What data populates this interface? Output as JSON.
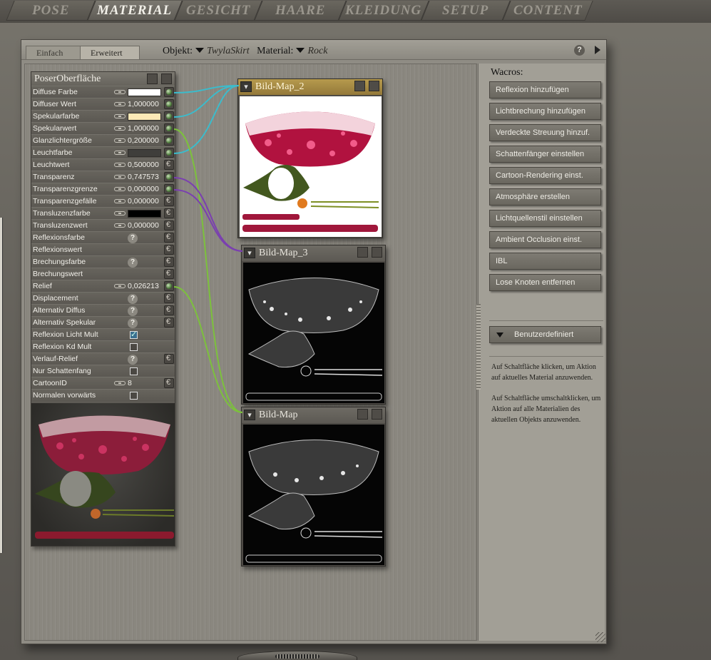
{
  "tabs": [
    "POSE",
    "MATERIAL",
    "GESICHT",
    "HAARE",
    "KLEIDUNG",
    "SETUP",
    "CONTENT"
  ],
  "active_tab": "MATERIAL",
  "subtabs": {
    "simple": "Einfach",
    "advanced": "Erweitert"
  },
  "object": {
    "label": "Objekt:",
    "value": "TwylaSkirt"
  },
  "material": {
    "label": "Material:",
    "value": "Rock"
  },
  "help_glyph": "?",
  "poser_node": {
    "title": "PoserOberfläche",
    "rows": [
      {
        "label": "Diffuse Farbe",
        "kind": "color",
        "color": "#ffffff",
        "port": "ball"
      },
      {
        "label": "Diffuser Wert",
        "kind": "value",
        "value": "1,000000",
        "port": "ball"
      },
      {
        "label": "Spekularfarbe",
        "kind": "color",
        "color": "#fde9b6",
        "port": "ball"
      },
      {
        "label": "Spekularwert",
        "kind": "value",
        "value": "1,000000",
        "port": "ball"
      },
      {
        "label": "Glanzlichtergröße",
        "kind": "value",
        "value": "0,200000",
        "port": "ball"
      },
      {
        "label": "Leuchtfarbe",
        "kind": "color",
        "color": "#3f3e3b",
        "port": "ball"
      },
      {
        "label": "Leuchtwert",
        "kind": "value",
        "value": "0,500000",
        "port": "c"
      },
      {
        "label": "Transparenz",
        "kind": "value",
        "value": "0,747573",
        "port": "ball"
      },
      {
        "label": "Transparenzgrenze",
        "kind": "value",
        "value": "0,000000",
        "port": "ball"
      },
      {
        "label": "Transparenzgefälle",
        "kind": "value",
        "value": "0,000000",
        "port": "c"
      },
      {
        "label": "Transluzenzfarbe",
        "kind": "color",
        "color": "#000000",
        "port": "c"
      },
      {
        "label": "Transluzenzwert",
        "kind": "value",
        "value": "0,000000",
        "port": "c"
      },
      {
        "label": "Reflexionsfarbe",
        "kind": "q",
        "port": "c"
      },
      {
        "label": "Reflexionswert",
        "kind": "none",
        "port": "c"
      },
      {
        "label": "Brechungsfarbe",
        "kind": "q",
        "port": "c"
      },
      {
        "label": "Brechungswert",
        "kind": "none",
        "port": "c"
      },
      {
        "label": "Relief",
        "kind": "value",
        "value": "0,026213",
        "port": "ball"
      },
      {
        "label": "Displacement",
        "kind": "q",
        "port": "c"
      },
      {
        "label": "Alternativ Diffus",
        "kind": "q",
        "port": "c"
      },
      {
        "label": "Alternativ Spekular",
        "kind": "q",
        "port": "c"
      },
      {
        "label": "Reflexion Licht Mult",
        "kind": "check",
        "checked": true,
        "port": "none"
      },
      {
        "label": "Reflexion Kd Mult",
        "kind": "check",
        "checked": false,
        "port": "none"
      },
      {
        "label": "Verlauf-Relief",
        "kind": "q",
        "port": "c"
      },
      {
        "label": "Nur Schattenfang",
        "kind": "check",
        "checked": false,
        "port": "none"
      },
      {
        "label": "CartoonID",
        "kind": "value",
        "value": "8",
        "port": "c"
      },
      {
        "label": "Normalen vorwärts",
        "kind": "check",
        "checked": false,
        "port": "none"
      }
    ]
  },
  "image_nodes": [
    {
      "title": "Bild-Map_2",
      "selected": true,
      "style": "color"
    },
    {
      "title": "Bild-Map_3",
      "selected": false,
      "style": "mask"
    },
    {
      "title": "Bild-Map",
      "selected": false,
      "style": "mask"
    }
  ],
  "wacros": {
    "title": "Wacros:",
    "buttons": [
      "Reflexion hinzufügen",
      "Lichtbrechung hinzufügen",
      "Verdeckte Streuung hinzuf.",
      "Schattenfänger einstellen",
      "Cartoon-Rendering einst.",
      "Atmosphäre erstellen",
      "Lichtquellenstil einstellen",
      "Ambient Occlusion einst.",
      "IBL",
      "Lose Knoten entfernen"
    ],
    "dropdown": "Benutzerdefiniert",
    "help1": "Auf Schaltfläche klicken, um Aktion auf aktuelles Material anzuwenden.",
    "help2": "Auf Schaltfläche umschaltklicken, um Aktion auf alle Materialien des aktuellen Objekts anzuwenden."
  },
  "colors": {
    "wire_cyan": "#3bbccc",
    "wire_green": "#7cc13c",
    "wire_purple": "#7a3fb0",
    "accent_gold": "#b69a4d"
  }
}
